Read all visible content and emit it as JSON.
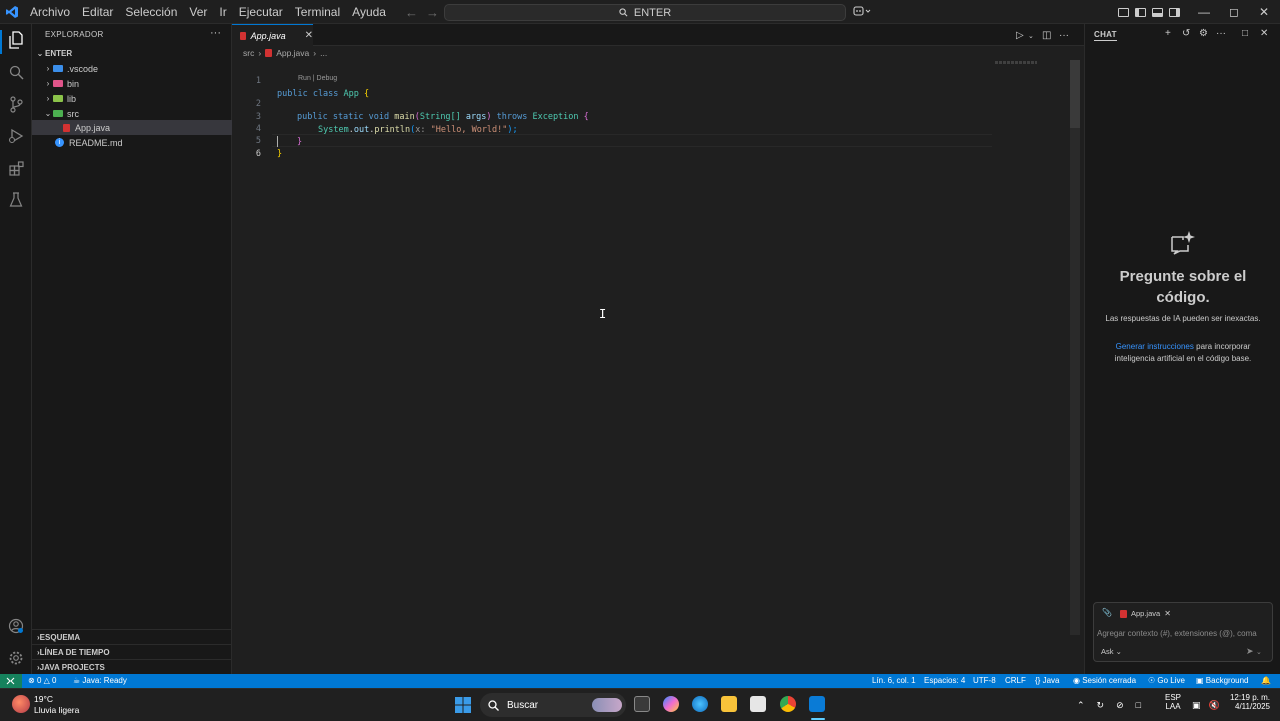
{
  "titlebar": {
    "menus": [
      "Archivo",
      "Editar",
      "Selección",
      "Ver",
      "Ir",
      "Ejecutar",
      "Terminal",
      "Ayuda"
    ],
    "command_center": "ENTER"
  },
  "sidebar": {
    "title": "EXPLORADOR",
    "root": "ENTER",
    "tree": [
      ".vscode",
      "bin",
      "lib",
      "src",
      "App.java",
      "README.md"
    ],
    "sections": [
      "ESQUEMA",
      "LÍNEA DE TIEMPO",
      "JAVA PROJECTS"
    ]
  },
  "editor": {
    "tab_label": "App.java",
    "breadcrumb": [
      "src",
      "App.java",
      "..."
    ],
    "codelens": "Run | Debug",
    "line_numbers": [
      "1",
      "2",
      "3",
      "4",
      "5",
      "6"
    ],
    "code": {
      "l1_kw": "public class ",
      "l1_cls": "App",
      "l1_br": " {",
      "l2_kw1": "public static void ",
      "l2_fn": "main",
      "l2_p1": "(",
      "l2_ty": "String[]",
      "l2_var": " args",
      "l2_p2": ") ",
      "l2_kw2": "throws ",
      "l2_ex": "Exception",
      "l2_br": " {",
      "l3_sys": "System",
      "l3_dot": ".",
      "l3_out": "out",
      "l3_dot2": ".",
      "l3_fn": "println",
      "l3_p1": "(",
      "l3_hint": "x: ",
      "l3_str": "\"Hello, World!\"",
      "l3_p2": ");",
      "l4": "}",
      "l5": "}"
    }
  },
  "chat": {
    "title": "CHAT",
    "heading": "Pregunte sobre el código.",
    "sub": "Las respuestas de IA pueden ser inexactas.",
    "link": "Generar instrucciones",
    "sub2_rest": " para incorporar inteligencia artificial en el código base.",
    "context_file": "App.java",
    "placeholder": "Agregar contexto (#), extensiones (@), coma",
    "mode": "Ask"
  },
  "statusbar": {
    "errors": "0",
    "warnings": "0",
    "java": "Java: Ready",
    "position": "Lín. 6, col. 1",
    "spaces": "Espacios: 4",
    "encoding": "UTF-8",
    "eol": "CRLF",
    "language": "Java",
    "session": "Sesión cerrada",
    "golive": "Go Live",
    "background": "Background"
  },
  "taskbar": {
    "weather_temp": "19°C",
    "weather_desc": "Lluvia ligera",
    "search": "Buscar",
    "lang1": "ESP",
    "lang2": "LAA",
    "time": "12:19 p. m.",
    "date": "4/11/2025"
  },
  "colors": {
    "accent": "#0078d4",
    "statusbar": "#0078d4",
    "remote": "#16825d",
    "java_icon": "#d23232"
  }
}
